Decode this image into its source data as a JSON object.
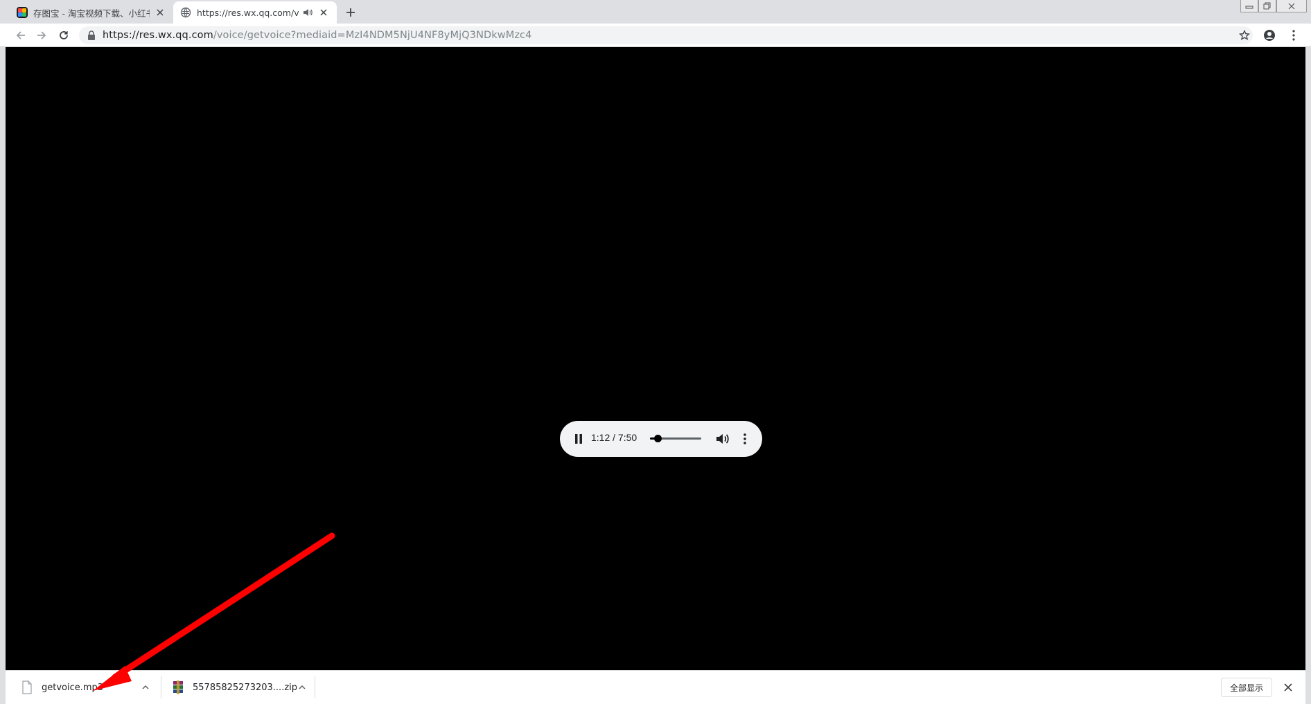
{
  "tabs": [
    {
      "title": "存图宝 - 淘宝视频下载、小红书",
      "icon": "app-colorful-icon",
      "active": false
    },
    {
      "title": "https://res.wx.qq.com/voic",
      "icon": "globe-icon",
      "active": true,
      "audio_icon": "speaker-icon"
    }
  ],
  "window_controls": {
    "minimize": "minimize-icon",
    "maximize": "restore-icon",
    "close": "close-icon"
  },
  "toolbar": {
    "url_host": "https://res.wx.qq.com",
    "url_path": "/voice/getvoice?mediaid=MzI4NDM5NjU4NF8yMjQ3NDkwMzc4",
    "back_icon": "arrow-left-icon",
    "forward_icon": "arrow-right-icon",
    "reload_icon": "reload-icon",
    "bookmark_icon": "star-icon",
    "profile_icon": "account-circle-icon",
    "menu_icon": "vertical-dots-icon"
  },
  "player": {
    "time": "1:12 / 7:50",
    "progress": 0.153,
    "state": "playing",
    "pause_icon": "pause-icon",
    "volume_icon": "volume-icon",
    "more_icon": "vertical-dots-icon"
  },
  "annotation": {
    "color": "#ff0000",
    "icon": "red-arrow"
  },
  "downloads": {
    "items": [
      {
        "filename": "getvoice.mp3",
        "icon": "file-icon"
      },
      {
        "filename": "55785825273203....zip",
        "icon": "archive-icon"
      }
    ],
    "show_all_label": "全部显示",
    "close_icon": "close-icon"
  }
}
